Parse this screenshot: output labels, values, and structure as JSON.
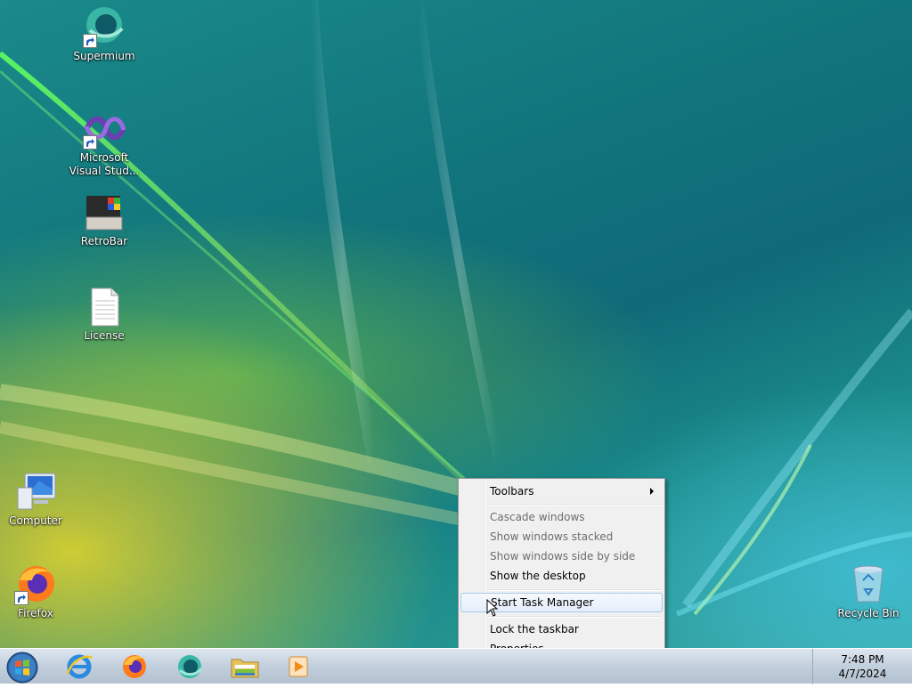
{
  "desktop": {
    "icons": [
      {
        "label": "Supermium",
        "icon": "supermium-icon",
        "shortcut": true
      },
      {
        "label": "Microsoft Visual Stud...",
        "label_line1": "Microsoft",
        "label_line2": "Visual Stud...",
        "icon": "visual-studio-icon",
        "shortcut": true
      },
      {
        "label": "RetroBar",
        "icon": "retrobar-icon",
        "shortcut": false
      },
      {
        "label": "License",
        "icon": "text-file-icon",
        "shortcut": false
      },
      {
        "label": "Computer",
        "icon": "computer-icon",
        "shortcut": false
      },
      {
        "label": "Firefox",
        "icon": "firefox-icon",
        "shortcut": true
      },
      {
        "label": "Recycle Bin",
        "icon": "recycle-bin-icon",
        "shortcut": false
      }
    ]
  },
  "taskbar": {
    "pinned": [
      "start-orb-icon",
      "internet-explorer-icon",
      "firefox-icon",
      "supermium-icon",
      "file-explorer-icon",
      "media-player-icon"
    ],
    "clock": {
      "time": "7:48 PM",
      "date": "4/7/2024"
    }
  },
  "context_menu": {
    "items": [
      {
        "label": "Toolbars",
        "enabled": true,
        "submenu": true
      },
      {
        "label": "Cascade windows",
        "enabled": false
      },
      {
        "label": "Show windows stacked",
        "enabled": false
      },
      {
        "label": "Show windows side by side",
        "enabled": false
      },
      {
        "label": "Show the desktop",
        "enabled": true
      },
      {
        "label": "Start Task Manager",
        "enabled": true,
        "highlighted": true
      },
      {
        "label": "Lock the taskbar",
        "enabled": true
      },
      {
        "label": "Properties",
        "enabled": true
      }
    ]
  },
  "colors": {
    "menu_bg": "#f0f0f0",
    "menu_highlight_border": "#a8c8ea",
    "taskbar_bg": "#c2cfdc",
    "disabled_text": "#6d6d6d"
  }
}
